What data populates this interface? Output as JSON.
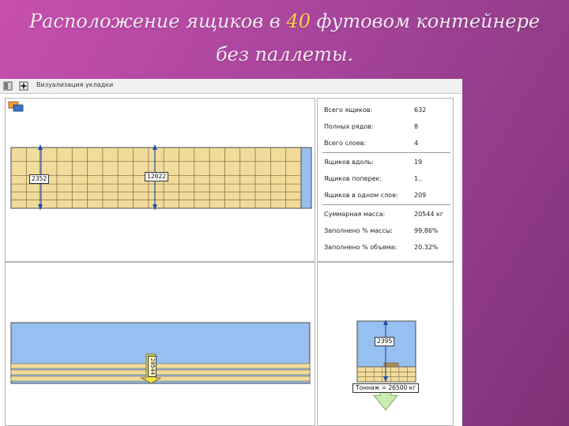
{
  "slide": {
    "title_line1_prefix": "Расположение ящиков в",
    "title_line1_number": "40",
    "title_line1_suffix": "футовом контейнере",
    "title_line2": "без паллеты."
  },
  "app": {
    "window_title": "Визуализация укладки"
  },
  "stats": {
    "rows": [
      {
        "label": "Всего ящиков:",
        "value": "632"
      },
      {
        "label": "Полных рядов:",
        "value": "8"
      },
      {
        "label": "Всего слоев:",
        "value": "4"
      },
      {
        "label": "Ящиков вдоль:",
        "value": "19"
      },
      {
        "label": "Ящиков поперек:",
        "value": "1.."
      },
      {
        "label": "Ящиков в одном слое:",
        "value": "209"
      },
      {
        "label": "Суммарная масса:",
        "value": "20544 кг"
      },
      {
        "label": "Заполнено % массы:",
        "value": "99,86%"
      },
      {
        "label": "Заполнено % объема:",
        "value": "20.32%"
      }
    ]
  },
  "top_view": {
    "height_label": "2352",
    "length_label": "12022"
  },
  "side_view": {
    "vertical_label": "20544"
  },
  "end_view": {
    "height_label": "2395",
    "tonnage_label": "Тоннаж = 26500 кг"
  },
  "colors": {
    "box_fill": "#f1dc9c",
    "box_line": "#7a6a3a",
    "container_blue": "#97bff0",
    "arrow_blue": "#1f4fa8",
    "title_highlight": "#f5d544"
  }
}
